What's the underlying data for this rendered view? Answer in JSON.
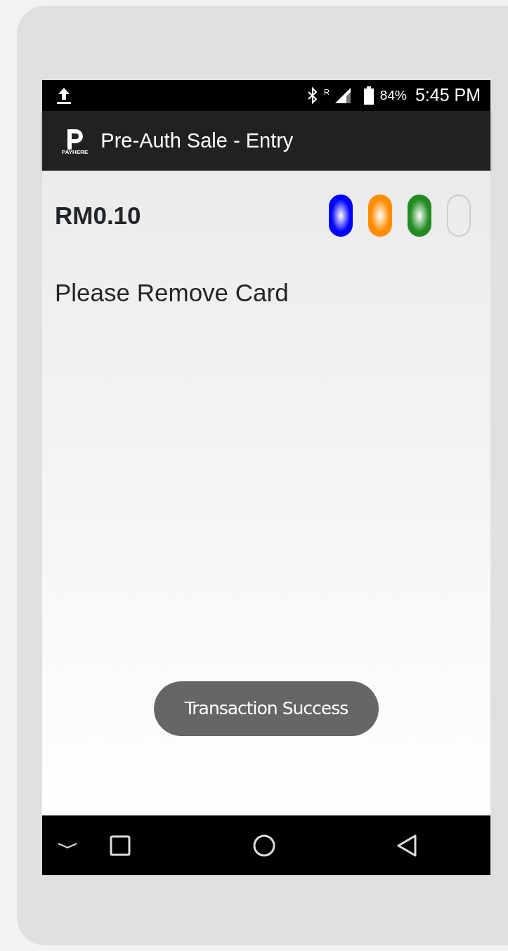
{
  "status_bar": {
    "battery": "84%",
    "time": "5:45 PM",
    "roaming": "R"
  },
  "app_bar": {
    "logo_text": "PAYHERE",
    "title": "Pre-Auth Sale - Entry"
  },
  "amount": "RM0.10",
  "leds": [
    {
      "color": "#0000ff",
      "on": true
    },
    {
      "color": "#ff8c00",
      "on": true
    },
    {
      "color": "#228b22",
      "on": true
    },
    {
      "color": "#cccccc",
      "on": false
    }
  ],
  "message": "Please Remove Card",
  "toast": "Transaction Success"
}
